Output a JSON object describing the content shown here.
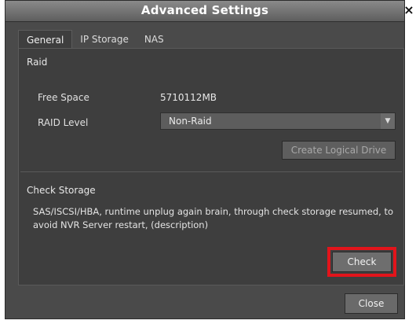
{
  "window": {
    "title": "Advanced Settings",
    "close_glyph": "×"
  },
  "tabs": [
    {
      "label": "General",
      "active": true
    },
    {
      "label": "IP Storage",
      "active": false
    },
    {
      "label": "NAS",
      "active": false
    }
  ],
  "raid": {
    "section_title": "Raid",
    "free_space_label": "Free Space",
    "free_space_value": "5710112MB",
    "raid_level_label": "RAID Level",
    "raid_level_value": "Non-Raid",
    "create_button": "Create Logical Drive"
  },
  "check_storage": {
    "section_title": "Check Storage",
    "description": "SAS/ISCSI/HBA, runtime unplug again brain, through check storage resumed, to avoid NVR Server restart, (description)",
    "check_button": "Check"
  },
  "footer": {
    "close_button": "Close"
  },
  "colors": {
    "highlight": "#e2141b"
  }
}
